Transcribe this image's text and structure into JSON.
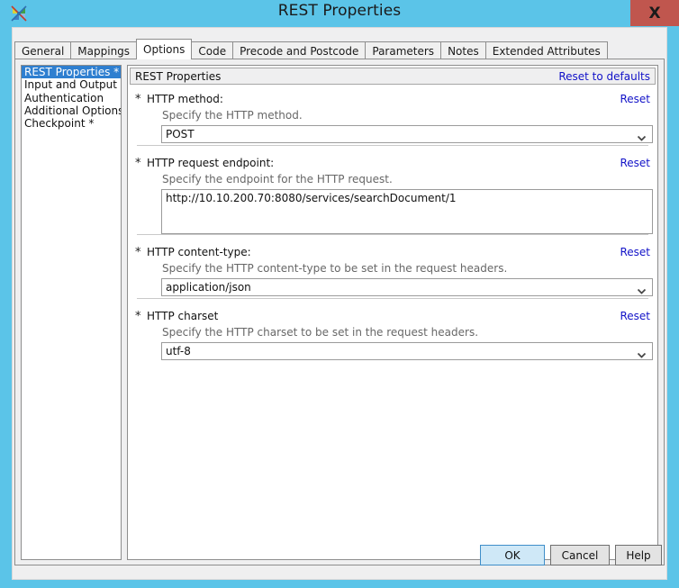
{
  "window": {
    "title": "REST Properties",
    "app_icon": "pinwheel-icon",
    "close_label": "X",
    "close_color": "#c0564e",
    "titlebar_color": "#5bc4e8",
    "accent_link_color": "#1212c8",
    "selection_color": "#2f7fd0"
  },
  "tabs": [
    {
      "label": "General",
      "active": false
    },
    {
      "label": "Mappings",
      "active": false
    },
    {
      "label": "Options",
      "active": true
    },
    {
      "label": "Code",
      "active": false
    },
    {
      "label": "Precode and Postcode",
      "active": false
    },
    {
      "label": "Parameters",
      "active": false
    },
    {
      "label": "Notes",
      "active": false
    },
    {
      "label": "Extended Attributes",
      "active": false
    }
  ],
  "sidebar": {
    "items": [
      {
        "label": "REST Properties *",
        "selected": true
      },
      {
        "label": "Input and Output",
        "selected": false
      },
      {
        "label": "Authentication",
        "selected": false
      },
      {
        "label": "Additional Options *",
        "selected": false
      },
      {
        "label": "Checkpoint *",
        "selected": false
      }
    ]
  },
  "content": {
    "header_title": "REST Properties",
    "reset_to_defaults": "Reset to defaults",
    "sections": [
      {
        "star": "*",
        "label": "HTTP method:",
        "reset": "Reset",
        "description": "Specify the HTTP method.",
        "control": "combo",
        "value": "POST"
      },
      {
        "star": "*",
        "label": "HTTP request endpoint:",
        "reset": "Reset",
        "description": "Specify the endpoint for the HTTP request.",
        "control": "textbox",
        "value": "http://10.10.200.70:8080/services/searchDocument/1"
      },
      {
        "star": "*",
        "label": "HTTP content-type:",
        "reset": "Reset",
        "description": "Specify the HTTP content-type to be set in the request headers.",
        "control": "combo",
        "value": "application/json"
      },
      {
        "star": "*",
        "label": "HTTP charset",
        "reset": "Reset",
        "description": "Specify the HTTP charset to be set in the request headers.",
        "control": "combo",
        "value": "utf-8"
      }
    ]
  },
  "footer": {
    "ok_label": "OK",
    "cancel_label": "Cancel",
    "help_label": "Help"
  }
}
